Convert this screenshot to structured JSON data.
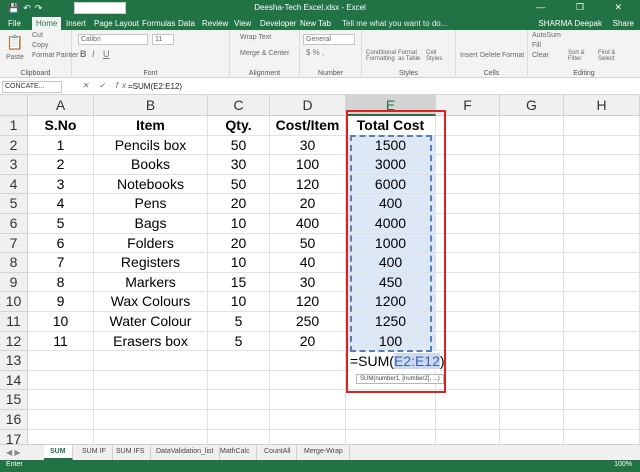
{
  "window": {
    "title": "Deesha-Tech Excel.xlsx - Excel",
    "controls": "— ❐ ✕",
    "qat_icons": "💾↶↷"
  },
  "ribbon_tabs": [
    "File",
    "Home",
    "Insert",
    "Page Layout",
    "Formulas",
    "Data",
    "Review",
    "View",
    "Developer",
    "New Tab"
  ],
  "tell_me": "Tell me what you want to do...",
  "user": "SHARMA Deepak",
  "share": "Share",
  "ribbon": {
    "clipboard": {
      "label": "Clipboard",
      "paste": "Paste",
      "cut": "Cut",
      "copy": "Copy",
      "format_painter": "Format Painter"
    },
    "font": {
      "label": "Font",
      "name": "Calibri",
      "size": "11"
    },
    "alignment": {
      "label": "Alignment",
      "wrap": "Wrap Text",
      "merge": "Merge & Center"
    },
    "number": {
      "label": "Number",
      "format": "General"
    },
    "styles": {
      "label": "Styles",
      "cond": "Conditional Formatting",
      "table": "Format as Table",
      "cell": "Cell Styles"
    },
    "cells": {
      "label": "Cells",
      "insert": "Insert",
      "delete": "Delete",
      "format": "Format"
    },
    "editing": {
      "label": "Editing",
      "autosum": "AutoSum",
      "fill": "Fill",
      "clear": "Clear",
      "sort": "Sort & Filter",
      "find": "Find & Select"
    }
  },
  "formula_bar": {
    "name_box": "CONCATE...",
    "fx": "✕ ✓ fx",
    "formula": "=SUM(E2:E12)"
  },
  "columns": [
    "A",
    "B",
    "C",
    "D",
    "E",
    "F",
    "G",
    "H"
  ],
  "row_numbers": [
    "1",
    "2",
    "3",
    "4",
    "5",
    "6",
    "7",
    "8",
    "9",
    "10",
    "11",
    "12",
    "13",
    "14",
    "15",
    "16",
    "17"
  ],
  "table": {
    "headers": [
      "S.No",
      "Item",
      "Qty.",
      "Cost/Item",
      "Total Cost"
    ],
    "rows": [
      [
        "1",
        "Pencils box",
        "50",
        "30",
        "1500"
      ],
      [
        "2",
        "Books",
        "30",
        "100",
        "3000"
      ],
      [
        "3",
        "Notebooks",
        "50",
        "120",
        "6000"
      ],
      [
        "4",
        "Pens",
        "20",
        "20",
        "400"
      ],
      [
        "5",
        "Bags",
        "10",
        "400",
        "4000"
      ],
      [
        "6",
        "Folders",
        "20",
        "50",
        "1000"
      ],
      [
        "7",
        "Registers",
        "10",
        "40",
        "400"
      ],
      [
        "8",
        "Markers",
        "15",
        "30",
        "450"
      ],
      [
        "9",
        "Wax Colours",
        "10",
        "120",
        "1200"
      ],
      [
        "10",
        "Water Colour",
        "5",
        "250",
        "1250"
      ],
      [
        "11",
        "Erasers box",
        "5",
        "20",
        "100"
      ]
    ]
  },
  "edit_cell": {
    "prefix": "=SUM(",
    "ref": "E2:E12",
    "suffix": ")"
  },
  "tooltip": "SUM(number1, [number2], ...)",
  "sheet_tabs": [
    "SUM",
    "SUM IF",
    "SUM IFS",
    "DataValidation_list",
    "MathCalc",
    "CountAll",
    "Merge-Wrap"
  ],
  "sheet_nav": "◀ ▶",
  "status": {
    "mode": "Enter",
    "zoom": "100%"
  },
  "colors": {
    "excel_green": "#217346",
    "highlight_red": "#e02020",
    "range_blue": "#dde8f6"
  }
}
